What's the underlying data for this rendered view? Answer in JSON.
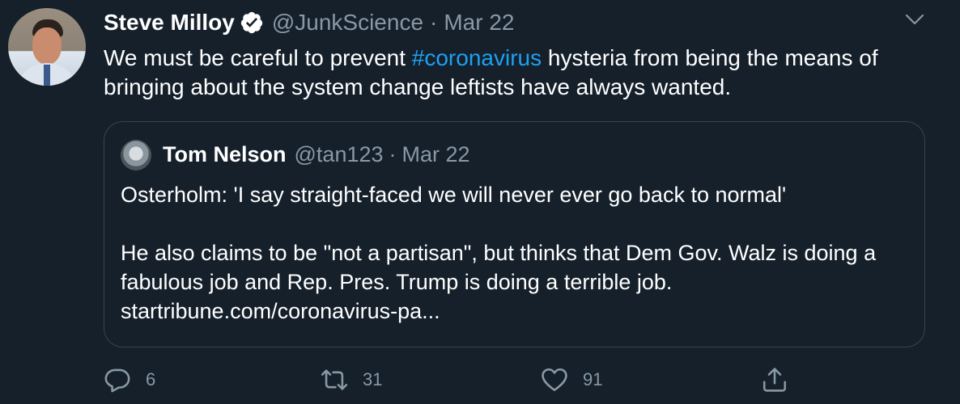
{
  "tweet": {
    "author_name": "Steve Milloy",
    "handle": "@JunkScience",
    "separator": "·",
    "date": "Mar 22",
    "text_before": "We must be careful to prevent ",
    "hashtag": "#coronavirus",
    "text_after": " hysteria from being the means of bringing about the system change leftists have always wanted."
  },
  "quoted_tweet": {
    "author_name": "Tom Nelson",
    "handle": "@tan123",
    "separator": "·",
    "date": "Mar 22",
    "paragraph_1": "Osterholm: 'I say straight-faced we will never ever go back to normal'",
    "paragraph_2": "He also claims to be \"not a partisan\", but thinks that Dem Gov. Walz is doing a fabulous job and Rep. Pres. Trump is doing a terrible job.",
    "link": "startribune.com/coronavirus-pa..."
  },
  "actions": {
    "reply_count": "6",
    "retweet_count": "31",
    "like_count": "91"
  },
  "icons": {
    "verified": "verified-badge-icon",
    "more": "chevron-down-icon",
    "reply": "reply-icon",
    "retweet": "retweet-icon",
    "like": "heart-icon",
    "share": "share-icon"
  },
  "colors": {
    "background": "#15202b",
    "link": "#1da1f2",
    "secondary_text": "#8899a6",
    "border": "#38444d"
  }
}
